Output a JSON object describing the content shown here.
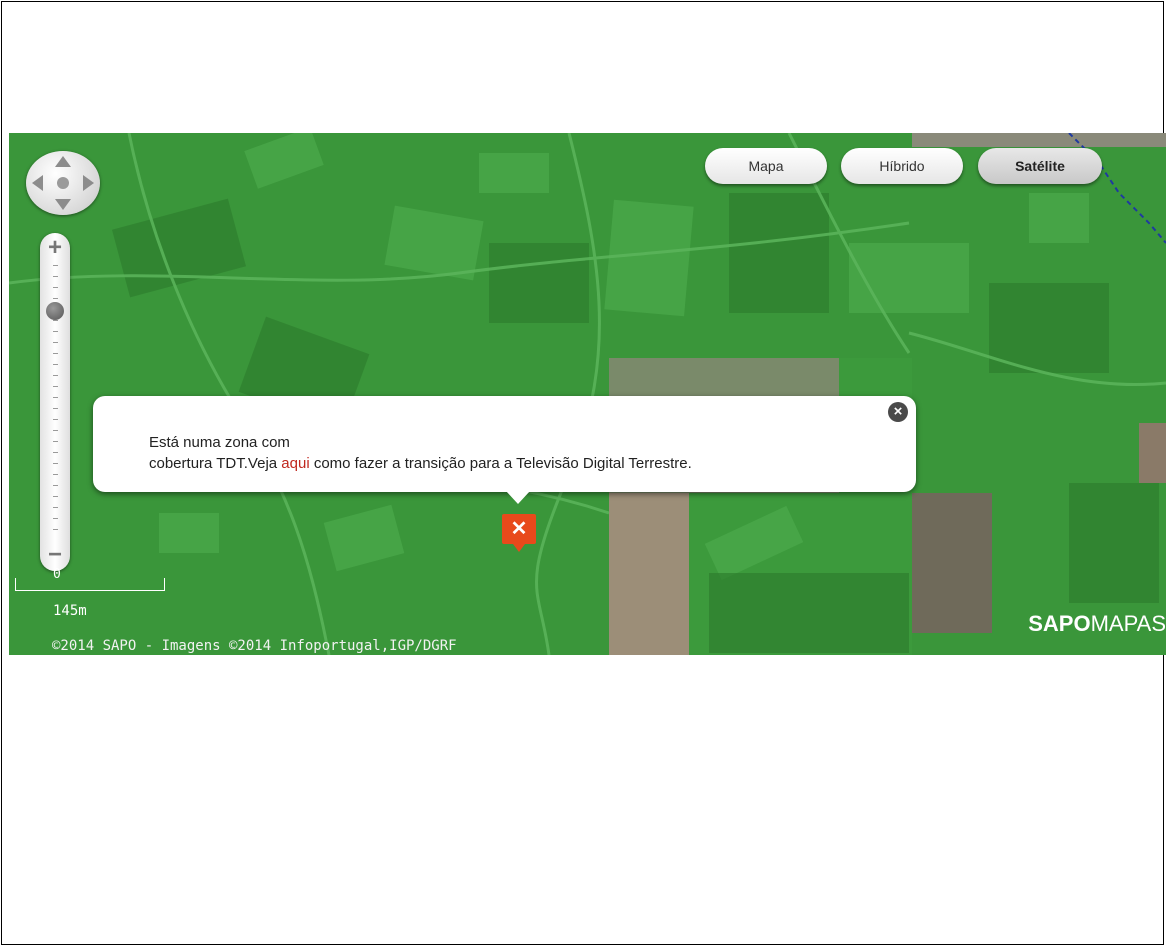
{
  "map_type_buttons": {
    "mapa": "Mapa",
    "hibrido": "Híbrido",
    "satelite": "Satélite",
    "active": "Satélite"
  },
  "zoom": {
    "plus": "+",
    "minus": "−",
    "level_fraction": 0.83
  },
  "scale": {
    "zero": "0",
    "label": "145m"
  },
  "attribution": "©2014 SAPO - Imagens ©2014 Infoportugal,IGP/DGRF",
  "logo": {
    "bold": "SAPO",
    "light": "MAPAS"
  },
  "info_bubble": {
    "line1": "Está numa zona com",
    "line2_before": "cobertura TDT.Veja ",
    "link_text": "aqui",
    "line2_after": " como fazer a transição para a Televisão Digital Terrestre.",
    "close": "×"
  },
  "marker": {
    "icon": "tdt-marker-icon"
  },
  "colors": {
    "coverage_overlay": "#3f9e3f",
    "marker": "#e84a1b",
    "link": "#c0281f"
  }
}
